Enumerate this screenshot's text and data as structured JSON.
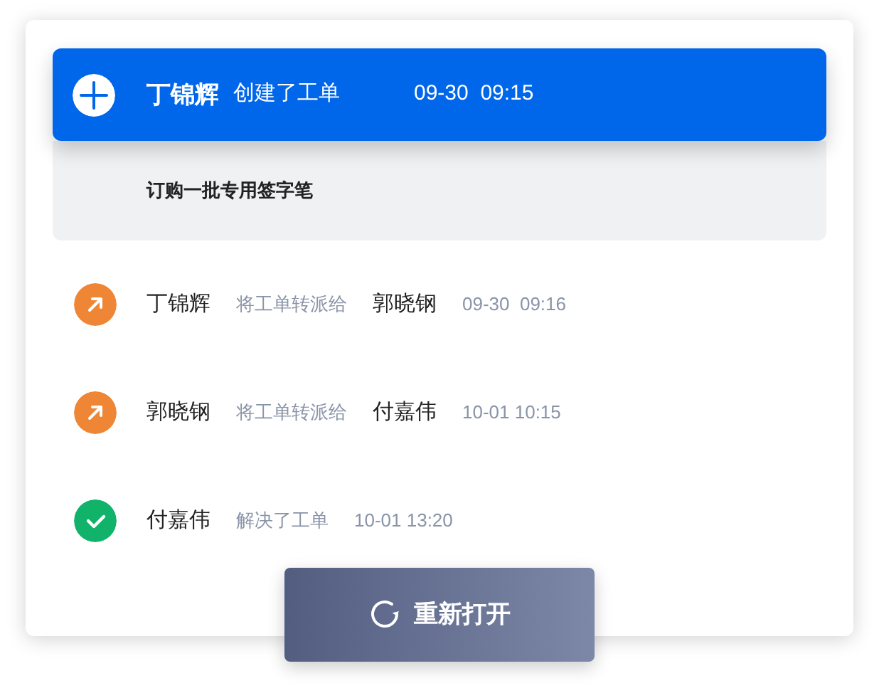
{
  "events": [
    {
      "kind": "create",
      "expanded": true,
      "actor": "丁锦辉",
      "action": "创建了工单",
      "time": "09-30  09:15",
      "note": "订购一批专用签字笔"
    },
    {
      "kind": "transfer",
      "expanded": false,
      "actor": "丁锦辉",
      "action": "将工单转派给",
      "target": "郭晓钢",
      "time": "09-30  09:16"
    },
    {
      "kind": "transfer",
      "expanded": false,
      "actor": "郭晓钢",
      "action": "将工单转派给",
      "target": "付嘉伟",
      "time": "10-01 10:15"
    },
    {
      "kind": "resolve",
      "expanded": false,
      "actor": "付嘉伟",
      "action": "解决了工单",
      "time": "10-01 13:20"
    }
  ],
  "reopen_button": {
    "label": "重新打开"
  }
}
